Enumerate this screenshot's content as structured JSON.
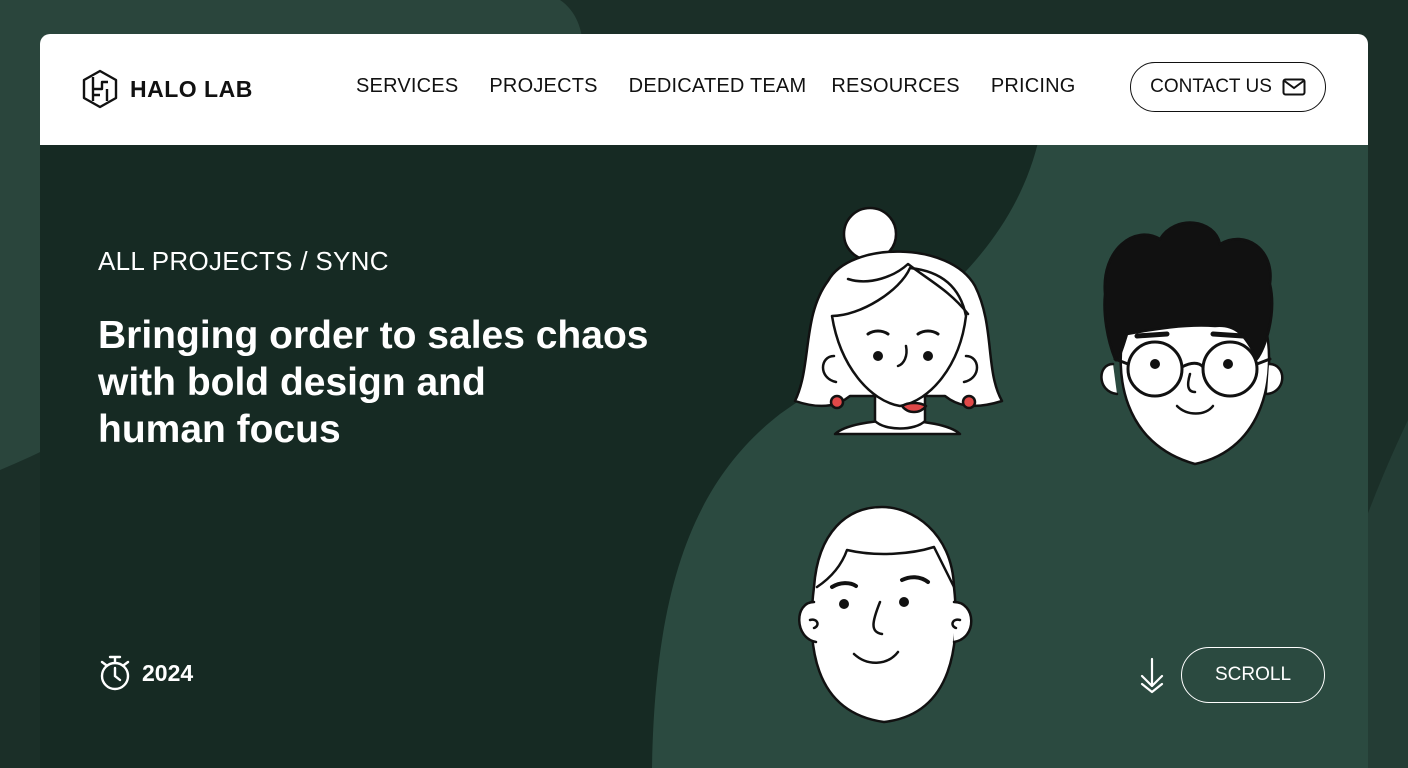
{
  "brand": {
    "name": "HALO LAB",
    "icon": "halo-lab-logo-icon"
  },
  "nav": {
    "items": [
      {
        "label": "SERVICES"
      },
      {
        "label": "PROJECTS"
      },
      {
        "label": "DEDICATED TEAM"
      },
      {
        "label": "RESOURCES"
      },
      {
        "label": "PRICING"
      }
    ],
    "contact": {
      "label": "CONTACT US",
      "icon": "mail-icon"
    }
  },
  "hero": {
    "breadcrumb": "ALL PROJECTS / SYNC",
    "title_lines": [
      "Bringing order to sales chaos",
      "with bold design and",
      "human focus"
    ],
    "year": {
      "icon": "stopwatch-icon",
      "value": "2024"
    },
    "scroll": {
      "label": "SCROLL",
      "icon": "arrow-down-icon"
    }
  },
  "illustrations": [
    "woman-avatar",
    "man-with-glasses-avatar",
    "man-avatar"
  ],
  "colors": {
    "background": "#1d322b",
    "card_dark": "#162a23",
    "card_light": "#2b4a40",
    "header": "#ffffff",
    "lipstick": "#e04848",
    "text_light": "#ffffff",
    "text_dark": "#111111"
  }
}
